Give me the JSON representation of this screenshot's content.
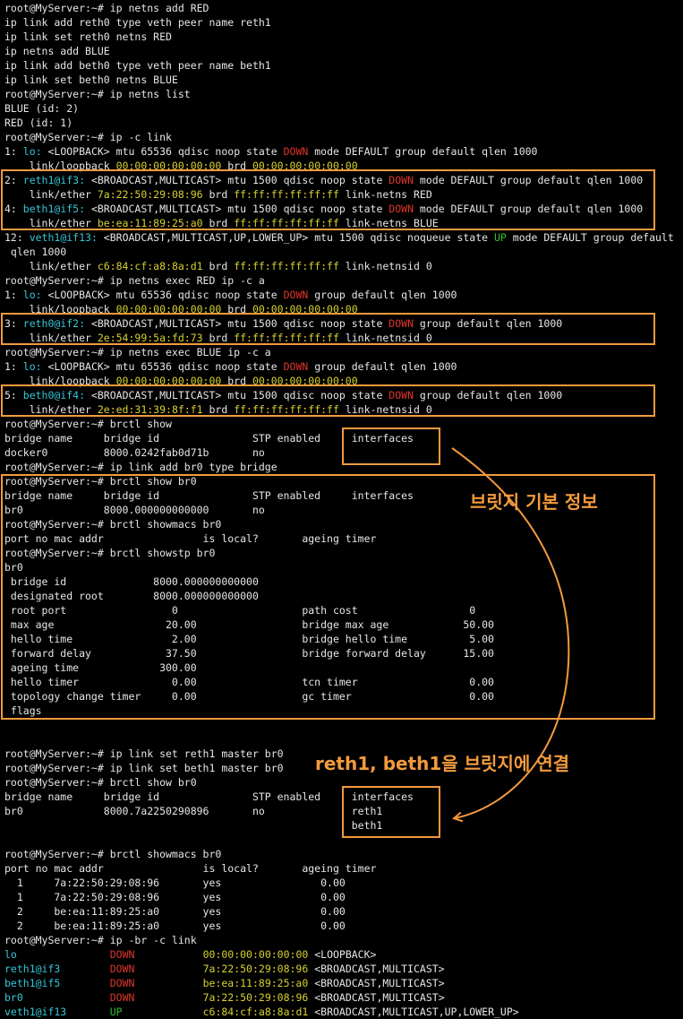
{
  "terminal": {
    "lines": [
      [
        {
          "t": "root@MyServer:~# ip netns add RED"
        }
      ],
      [
        {
          "t": "ip link add reth0 type veth peer name reth1"
        }
      ],
      [
        {
          "t": "ip link set reth0 netns RED"
        }
      ],
      [
        {
          "t": "ip netns add BLUE"
        }
      ],
      [
        {
          "t": "ip link add beth0 type veth peer name beth1"
        }
      ],
      [
        {
          "t": "ip link set beth0 netns BLUE"
        }
      ],
      [
        {
          "t": "root@MyServer:~# ip netns list"
        }
      ],
      [
        {
          "t": "BLUE (id: 2)"
        }
      ],
      [
        {
          "t": "RED (id: 1)"
        }
      ],
      [
        {
          "t": "root@MyServer:~# ip -c link"
        }
      ],
      [
        {
          "t": "1: "
        },
        {
          "t": "lo:",
          "c": "cyan"
        },
        {
          "t": " <LOOPBACK> mtu 65536 qdisc noop state "
        },
        {
          "t": "DOWN",
          "c": "red"
        },
        {
          "t": " mode DEFAULT group default qlen 1000"
        }
      ],
      [
        {
          "t": "    link/loopback "
        },
        {
          "t": "00:00:00:00:00:00",
          "c": "yellow"
        },
        {
          "t": " brd "
        },
        {
          "t": "00:00:00:00:00:00",
          "c": "yellow"
        }
      ],
      [
        {
          "t": "2: "
        },
        {
          "t": "reth1@if3:",
          "c": "cyan"
        },
        {
          "t": " <BROADCAST,MULTICAST> mtu 1500 qdisc noop state "
        },
        {
          "t": "DOWN",
          "c": "red"
        },
        {
          "t": " mode DEFAULT group default qlen 1000"
        }
      ],
      [
        {
          "t": "    link/ether "
        },
        {
          "t": "7a:22:50:29:08:96",
          "c": "yellow"
        },
        {
          "t": " brd "
        },
        {
          "t": "ff:ff:ff:ff:ff:ff",
          "c": "yellow"
        },
        {
          "t": " link-netns RED"
        }
      ],
      [
        {
          "t": "4: "
        },
        {
          "t": "beth1@if5:",
          "c": "cyan"
        },
        {
          "t": " <BROADCAST,MULTICAST> mtu 1500 qdisc noop state "
        },
        {
          "t": "DOWN",
          "c": "red"
        },
        {
          "t": " mode DEFAULT group default qlen 1000"
        }
      ],
      [
        {
          "t": "    link/ether "
        },
        {
          "t": "be:ea:11:89:25:a0",
          "c": "yellow"
        },
        {
          "t": " brd "
        },
        {
          "t": "ff:ff:ff:ff:ff:ff",
          "c": "yellow"
        },
        {
          "t": " link-netns BLUE"
        }
      ],
      [
        {
          "t": "12: "
        },
        {
          "t": "veth1@if13:",
          "c": "cyan"
        },
        {
          "t": " <BROADCAST,MULTICAST,UP,LOWER_UP> mtu 1500 qdisc noqueue state "
        },
        {
          "t": "UP",
          "c": "green"
        },
        {
          "t": " mode DEFAULT group default"
        }
      ],
      [
        {
          "t": " qlen 1000"
        }
      ],
      [
        {
          "t": "    link/ether "
        },
        {
          "t": "c6:84:cf:a8:8a:d1",
          "c": "yellow"
        },
        {
          "t": " brd "
        },
        {
          "t": "ff:ff:ff:ff:ff:ff",
          "c": "yellow"
        },
        {
          "t": " link-netnsid 0"
        }
      ],
      [
        {
          "t": "root@MyServer:~# ip netns exec RED ip -c a"
        }
      ],
      [
        {
          "t": "1: "
        },
        {
          "t": "lo:",
          "c": "cyan"
        },
        {
          "t": " <LOOPBACK> mtu 65536 qdisc noop state "
        },
        {
          "t": "DOWN",
          "c": "red"
        },
        {
          "t": " group default qlen 1000"
        }
      ],
      [
        {
          "t": "    link/loopback "
        },
        {
          "t": "00:00:00:00:00:00",
          "c": "yellow"
        },
        {
          "t": " brd "
        },
        {
          "t": "00:00:00:00:00:00",
          "c": "yellow"
        }
      ],
      [
        {
          "t": "3: "
        },
        {
          "t": "reth0@if2:",
          "c": "cyan"
        },
        {
          "t": " <BROADCAST,MULTICAST> mtu 1500 qdisc noop state "
        },
        {
          "t": "DOWN",
          "c": "red"
        },
        {
          "t": " group default qlen 1000"
        }
      ],
      [
        {
          "t": "    link/ether "
        },
        {
          "t": "2e:54:99:5a:fd:73",
          "c": "yellow"
        },
        {
          "t": " brd "
        },
        {
          "t": "ff:ff:ff:ff:ff:ff",
          "c": "yellow"
        },
        {
          "t": " link-netnsid 0"
        }
      ],
      [
        {
          "t": "root@MyServer:~# ip netns exec BLUE ip -c a"
        }
      ],
      [
        {
          "t": "1: "
        },
        {
          "t": "lo:",
          "c": "cyan"
        },
        {
          "t": " <LOOPBACK> mtu 65536 qdisc noop state "
        },
        {
          "t": "DOWN",
          "c": "red"
        },
        {
          "t": " group default qlen 1000"
        }
      ],
      [
        {
          "t": "    link/loopback "
        },
        {
          "t": "00:00:00:00:00:00",
          "c": "yellow"
        },
        {
          "t": " brd "
        },
        {
          "t": "00:00:00:00:00:00",
          "c": "yellow"
        }
      ],
      [
        {
          "t": "5: "
        },
        {
          "t": "beth0@if4:",
          "c": "cyan"
        },
        {
          "t": " <BROADCAST,MULTICAST> mtu 1500 qdisc noop state "
        },
        {
          "t": "DOWN",
          "c": "red"
        },
        {
          "t": " group default qlen 1000"
        }
      ],
      [
        {
          "t": "    link/ether "
        },
        {
          "t": "2e:ed:31:39:8f:f1",
          "c": "yellow"
        },
        {
          "t": " brd "
        },
        {
          "t": "ff:ff:ff:ff:ff:ff",
          "c": "yellow"
        },
        {
          "t": " link-netnsid 0"
        }
      ],
      [
        {
          "t": "root@MyServer:~# brctl show"
        }
      ],
      [
        {
          "t": "bridge name     bridge id               STP enabled     interfaces"
        }
      ],
      [
        {
          "t": "docker0         8000.0242fab0d71b       no"
        }
      ],
      [
        {
          "t": "root@MyServer:~# ip link add br0 type bridge"
        }
      ],
      [
        {
          "t": "root@MyServer:~# brctl show br0"
        }
      ],
      [
        {
          "t": "bridge name     bridge id               STP enabled     interfaces"
        }
      ],
      [
        {
          "t": "br0             8000.000000000000       no"
        }
      ],
      [
        {
          "t": "root@MyServer:~# brctl showmacs br0"
        }
      ],
      [
        {
          "t": "port no mac addr                is local?       ageing timer"
        }
      ],
      [
        {
          "t": "root@MyServer:~# brctl showstp br0"
        }
      ],
      [
        {
          "t": "br0"
        }
      ],
      [
        {
          "t": " bridge id              8000.000000000000"
        }
      ],
      [
        {
          "t": " designated root        8000.000000000000"
        }
      ],
      [
        {
          "t": " root port                 0                    path cost                  0"
        }
      ],
      [
        {
          "t": " max age                  20.00                 bridge max age            50.00"
        }
      ],
      [
        {
          "t": " hello time                2.00                 bridge hello time          5.00"
        }
      ],
      [
        {
          "t": " forward delay            37.50                 bridge forward delay      15.00"
        }
      ],
      [
        {
          "t": " ageing time             300.00"
        }
      ],
      [
        {
          "t": " hello timer               0.00                 tcn timer                  0.00"
        }
      ],
      [
        {
          "t": " topology change timer     0.00                 gc timer                   0.00"
        }
      ],
      [
        {
          "t": " flags"
        }
      ],
      [
        {
          "t": ""
        }
      ],
      [
        {
          "t": ""
        }
      ],
      [
        {
          "t": "root@MyServer:~# ip link set reth1 master br0"
        }
      ],
      [
        {
          "t": "root@MyServer:~# ip link set beth1 master br0"
        }
      ],
      [
        {
          "t": "root@MyServer:~# brctl show br0"
        }
      ],
      [
        {
          "t": "bridge name     bridge id               STP enabled     interfaces"
        }
      ],
      [
        {
          "t": "br0             8000.7a2250290896       no              reth1"
        }
      ],
      [
        {
          "t": "                                                        beth1"
        }
      ],
      [
        {
          "t": ""
        }
      ],
      [
        {
          "t": "root@MyServer:~# brctl showmacs br0"
        }
      ],
      [
        {
          "t": "port no mac addr                is local?       ageing timer"
        }
      ],
      [
        {
          "t": "  1     7a:22:50:29:08:96       yes                0.00"
        }
      ],
      [
        {
          "t": "  1     7a:22:50:29:08:96       yes                0.00"
        }
      ],
      [
        {
          "t": "  2     be:ea:11:89:25:a0       yes                0.00"
        }
      ],
      [
        {
          "t": "  2     be:ea:11:89:25:a0       yes                0.00"
        }
      ],
      [
        {
          "t": "root@MyServer:~# ip -br -c link"
        }
      ],
      [
        {
          "t": "lo",
          "c": "cyan"
        },
        {
          "t": "               "
        },
        {
          "t": "DOWN",
          "c": "red"
        },
        {
          "t": "           "
        },
        {
          "t": "00:00:00:00:00:00",
          "c": "yellow"
        },
        {
          "t": " <LOOPBACK>"
        }
      ],
      [
        {
          "t": "reth1@if3",
          "c": "cyan"
        },
        {
          "t": "        "
        },
        {
          "t": "DOWN",
          "c": "red"
        },
        {
          "t": "           "
        },
        {
          "t": "7a:22:50:29:08:96",
          "c": "yellow"
        },
        {
          "t": " <BROADCAST,MULTICAST>"
        }
      ],
      [
        {
          "t": "beth1@if5",
          "c": "cyan"
        },
        {
          "t": "        "
        },
        {
          "t": "DOWN",
          "c": "red"
        },
        {
          "t": "           "
        },
        {
          "t": "be:ea:11:89:25:a0",
          "c": "yellow"
        },
        {
          "t": " <BROADCAST,MULTICAST>"
        }
      ],
      [
        {
          "t": "br0",
          "c": "cyan"
        },
        {
          "t": "              "
        },
        {
          "t": "DOWN",
          "c": "red"
        },
        {
          "t": "           "
        },
        {
          "t": "7a:22:50:29:08:96",
          "c": "yellow"
        },
        {
          "t": " <BROADCAST,MULTICAST>"
        }
      ],
      [
        {
          "t": "veth1@if13",
          "c": "cyan"
        },
        {
          "t": "       "
        },
        {
          "t": "UP",
          "c": "green"
        },
        {
          "t": "             "
        },
        {
          "t": "c6:84:cf:a8:8a:d1",
          "c": "yellow"
        },
        {
          "t": " <BROADCAST,MULTICAST,UP,LOWER_UP>"
        }
      ]
    ]
  },
  "annotations": {
    "bridge_info_label": "브릿지 기본 정보",
    "connect_label": "reth1, beth1을 브릿지에 연결"
  },
  "colors": {
    "highlight": "#f39a3e",
    "background": "#000000",
    "text": "#e6e6e6",
    "red": "#e0352b",
    "cyan": "#36c6d6",
    "yellow": "#d8d030",
    "green": "#2fbf2f"
  }
}
